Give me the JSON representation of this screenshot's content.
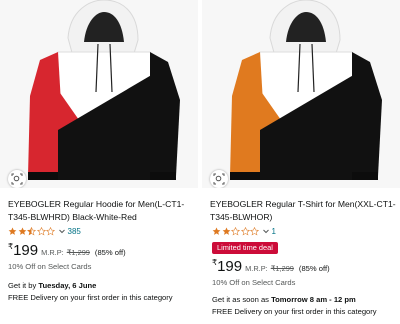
{
  "products": [
    {
      "title": "EYEBOGLER Regular Hoodie for Men(L-CT1-T345-BLWHRD) Black-White-Red",
      "rating_count": "385",
      "rating": 2.5,
      "deal_badge": "",
      "price_currency": "₹",
      "price": "199",
      "mrp_label": "M.R.P:",
      "mrp": "₹1,299",
      "discount": "(85% off)",
      "offer": "10% Off on Select Cards",
      "delivery_prefix": "Get it by ",
      "delivery_date": "Tuesday, 6 June",
      "delivery_free": "FREE Delivery on your first order in this category",
      "colors": {
        "panel": "#d7262f",
        "top": "#ffffff",
        "body": "#111111"
      }
    },
    {
      "title": "EYEBOGLER Regular T-Shirt for Men(XXL-CT1-T345-BLWHOR)",
      "rating_count": "1",
      "rating": 2.0,
      "deal_badge": "Limited time deal",
      "price_currency": "₹",
      "price": "199",
      "mrp_label": "M.R.P:",
      "mrp": "₹1,299",
      "discount": "(85% off)",
      "offer": "10% Off on Select Cards",
      "delivery_prefix": "Get it as soon as ",
      "delivery_date": "Tomorrow 8 am - 12 pm",
      "delivery_free": "FREE Delivery on your first order in this category",
      "colors": {
        "panel": "#e07a1f",
        "top": "#ffffff",
        "body": "#111111"
      }
    }
  ],
  "theme": {
    "star": "#de7921",
    "link": "#007185",
    "deal": "#cc0c39"
  }
}
